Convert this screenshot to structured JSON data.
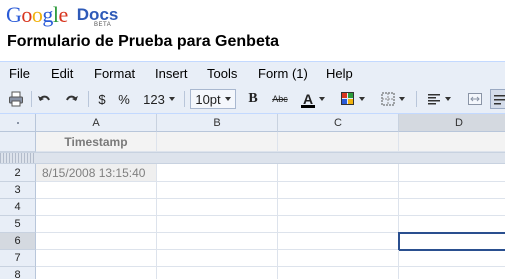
{
  "header": {
    "logo_letters": [
      "G",
      "o",
      "o",
      "g",
      "l",
      "e"
    ],
    "logo_colors": [
      "#2a5bd7",
      "#d8351e",
      "#f1b20d",
      "#2a5bd7",
      "#2c9b3b",
      "#d8351e"
    ],
    "logo_docs": "Docs",
    "logo_beta": "BETA",
    "doc_title": "Formulario de Prueba para Genbeta"
  },
  "menu": {
    "file": "File",
    "edit": "Edit",
    "format": "Format",
    "insert": "Insert",
    "tools": "Tools",
    "form": "Form (1)",
    "help": "Help"
  },
  "toolbar": {
    "currency": "$",
    "percent": "%",
    "number_format": "123",
    "font_size": "10pt",
    "bold": "B",
    "strikethrough": "Abc",
    "text_color_glyph": "A"
  },
  "grid": {
    "columns": [
      "A",
      "B",
      "C",
      "D"
    ],
    "row_numbers": [
      "2",
      "3",
      "4",
      "5",
      "6",
      "7",
      "8"
    ],
    "header_row": {
      "a": "Timestamp"
    },
    "rows": [
      {
        "a": "8/15/2008 13:15:40"
      }
    ],
    "selected_row": "6",
    "selected_column": "D"
  }
}
